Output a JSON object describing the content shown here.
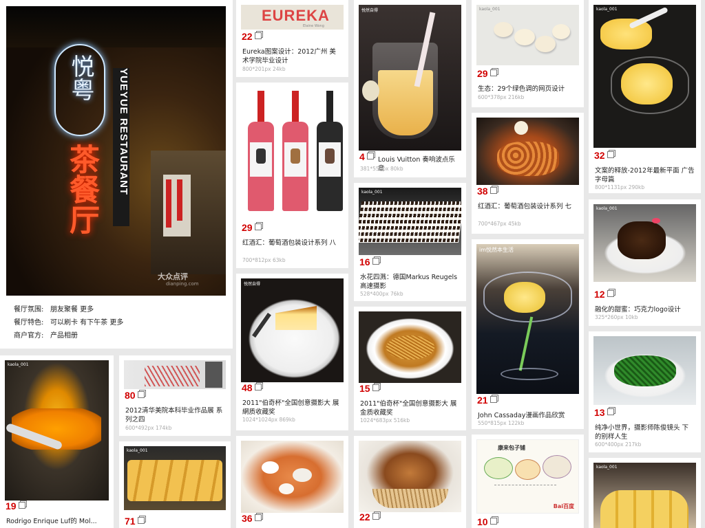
{
  "hero": {
    "info": [
      {
        "label": "餐厅氛围:",
        "value": "朋友聚餐 更多"
      },
      {
        "label": "餐厅特色:",
        "value": "可以刷卡 有下午茶 更多"
      },
      {
        "label": "商户官方:",
        "value": "产品相册"
      }
    ],
    "sign_vertical": "YUEYUE RESTAURANT",
    "sign_logo": "悦粤",
    "sign_red": "茶餐厅",
    "watermark": "大众点评",
    "watermark_site": "dianping.com"
  },
  "cards": {
    "c1": {
      "num": "19",
      "title": "Rodrigo Enrique Luf的 Mol...",
      "meta": "",
      "tag": "kaola_001"
    },
    "c2": {
      "num": "80",
      "title": "2012清华美院本科毕业作品展 系列之四",
      "meta": "600*492px 174kb"
    },
    "c3": {
      "num": "71",
      "title": "",
      "meta": "",
      "tag": "kaola_001"
    },
    "c4": {
      "num": "22",
      "title": "Eureka图案设计：2012广州 美术学院毕业设计",
      "meta": "800*201px 24kb",
      "logo": "EUREKA",
      "logo_sub": "Elaine Wong"
    },
    "c5": {
      "num": "29",
      "title": "红酒汇：葡萄酒包装设计系列 八",
      "meta": "700*812px 63kb"
    },
    "c6": {
      "num": "48",
      "title": "2011\"伯奇杯\"全国创意摄影大 展網质收藏奖",
      "meta": "1024*1024px 869kb",
      "tag": "悦然自得"
    },
    "c7": {
      "num": "36",
      "title": "",
      "meta": ""
    },
    "c8": {
      "num": "4",
      "title": "Louis Vuitton 奏响波点乐章",
      "meta": "381*555px 80kb",
      "tag": "悦然自得"
    },
    "c9": {
      "num": "16",
      "title": "水花四溅：德国Markus Reugels高速摄影",
      "meta": "528*400px 76kb",
      "tag": "kaola_001"
    },
    "c10": {
      "num": "15",
      "title": "2011\"伯奇杯\"全国创意摄影大 展金质收藏奖",
      "meta": "1024*683px 516kb"
    },
    "c11": {
      "num": "22",
      "title": "",
      "meta": ""
    },
    "c12": {
      "num": "29",
      "title": "生态：29个绿色调的网页设计",
      "meta": "600*378px 216kb",
      "tag": "kaola_001"
    },
    "c13": {
      "num": "38",
      "title": "红酒汇：葡萄酒包装设计系列 七",
      "meta": "700*467px 45kb"
    },
    "c14": {
      "num": "21",
      "title": "John Cassaday漫画作品欣赏",
      "meta": "550*815px 122kb",
      "tag": "im悦然本生活"
    },
    "c15": {
      "num": "10",
      "title": "",
      "meta": "",
      "map_title": "康来包子铺",
      "map_brand": "Bai百度"
    },
    "c16": {
      "num": "32",
      "title": "文案的释放-2012年最新平面 广告字母篇",
      "meta": "800*1131px 290kb",
      "tag": "kaola_001"
    },
    "c17": {
      "num": "12",
      "title": "融化的甜蜜：巧克力logo设计",
      "meta": "325*260px 10kb",
      "tag": "kaola_001"
    },
    "c18": {
      "num": "13",
      "title": "纯净小世界，摄影师陈俊镜头 下的别样人生",
      "meta": "600*400px 217kb"
    },
    "c19": {
      "num": "",
      "title": "",
      "meta": "",
      "tag": "kaola_001"
    }
  },
  "watermark": "大众点评"
}
